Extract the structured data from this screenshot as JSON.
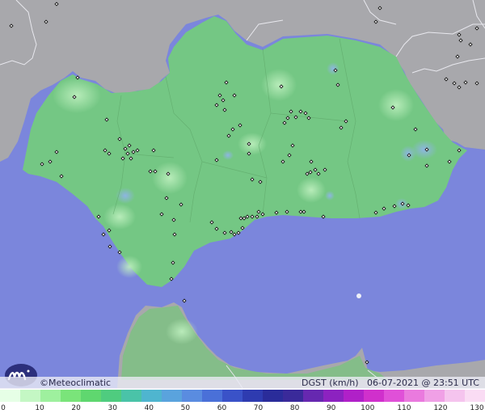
{
  "map": {
    "brand": "Meteoclimatic",
    "copyright_symbol": "©",
    "variable": "DGST (km/h)",
    "date": "06-07-2021",
    "time": "23:51 UTC",
    "colors": {
      "sea": "#7b86dc",
      "land_outside": "#a8a8ac",
      "land_andalucia": "#74c784",
      "gust_glow": "#a8e8a8",
      "gust_blue": "#8fb4e8",
      "station": "#1a1a1a"
    },
    "station_marker_icon": "diamond-icon",
    "logo_icon": "meteoclimatic-logo-icon"
  },
  "legend": {
    "ticks": [
      "0",
      "10",
      "20",
      "30",
      "40",
      "50",
      "60",
      "70",
      "80",
      "90",
      "100",
      "110",
      "120",
      "130"
    ],
    "colors": [
      "#e6ffe6",
      "#c4f7c4",
      "#9ef09e",
      "#7ae47a",
      "#5fd76f",
      "#4fcc7f",
      "#4ac3a8",
      "#4fb5cf",
      "#5aa3dd",
      "#5a8ce0",
      "#4a70d8",
      "#3a52c8",
      "#2e3bb0",
      "#2a2c9a",
      "#3a2a9a",
      "#6628b0",
      "#8c22c0",
      "#b020c8",
      "#d030cc",
      "#e050d8",
      "#ea7ade",
      "#f0a0e6",
      "#f5c4ee",
      "#fadcf4"
    ]
  }
}
